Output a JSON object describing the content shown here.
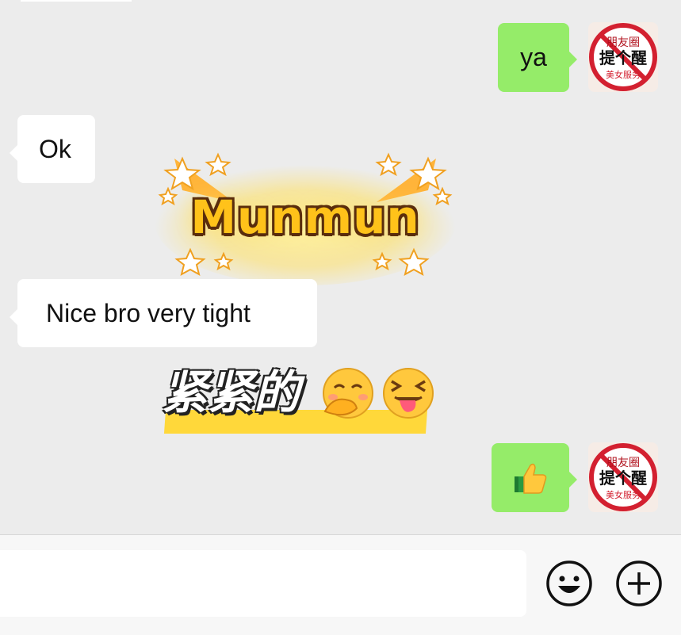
{
  "messages": [
    {
      "side": "out",
      "text": "ya",
      "avatar_icon": "reminder-stamp-avatar-icon"
    },
    {
      "side": "in",
      "text": "Ok"
    },
    {
      "side": "sticker",
      "text": "Munmun"
    },
    {
      "side": "in",
      "text": "Nice bro very tight"
    },
    {
      "side": "sticker",
      "text": "紧紧的",
      "emojis": [
        "hand-over-mouth-emoji",
        "squinting-tongue-emoji"
      ]
    },
    {
      "side": "out",
      "icon": "thumbs-up-icon",
      "avatar_icon": "reminder-stamp-avatar-icon"
    }
  ],
  "avatar_stamp": {
    "line1": "朋友圈",
    "line2": "提个醒",
    "line3": "美女服务"
  },
  "composer": {
    "emoji_button_icon": "smiley-icon",
    "plus_button_icon": "plus-icon"
  },
  "colors": {
    "background": "#ececec",
    "outgoing_bubble": "#95ec69",
    "incoming_bubble": "#ffffff",
    "stamp_red": "#d32030"
  }
}
